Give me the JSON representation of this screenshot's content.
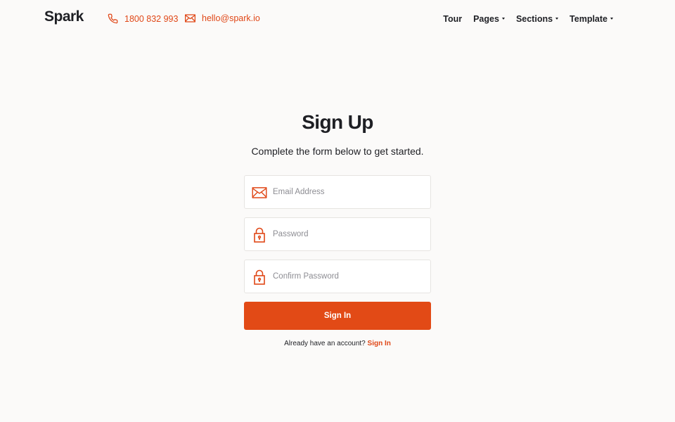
{
  "header": {
    "logo": "Spark",
    "phone": "1800 832 993",
    "email": "hello@spark.io",
    "nav": [
      {
        "label": "Tour",
        "dropdown": false
      },
      {
        "label": "Pages",
        "dropdown": true
      },
      {
        "label": "Sections",
        "dropdown": true
      },
      {
        "label": "Template",
        "dropdown": true
      }
    ]
  },
  "form": {
    "title": "Sign Up",
    "subtitle": "Complete the form below to get started.",
    "email_placeholder": "Email Address",
    "email_value": "",
    "password_placeholder": "Password",
    "password_value": "",
    "confirm_placeholder": "Confirm Password",
    "confirm_value": "",
    "submit_label": "Sign In",
    "account_prompt": "Already have an account?",
    "signin_link": "Sign In"
  },
  "colors": {
    "accent": "#e24a16",
    "background": "#fbfaf9",
    "text": "#1e1f24"
  },
  "icons": {
    "phone": "phone-icon",
    "email": "envelope-icon",
    "lock": "lock-icon",
    "caret": "caret-down-icon"
  }
}
